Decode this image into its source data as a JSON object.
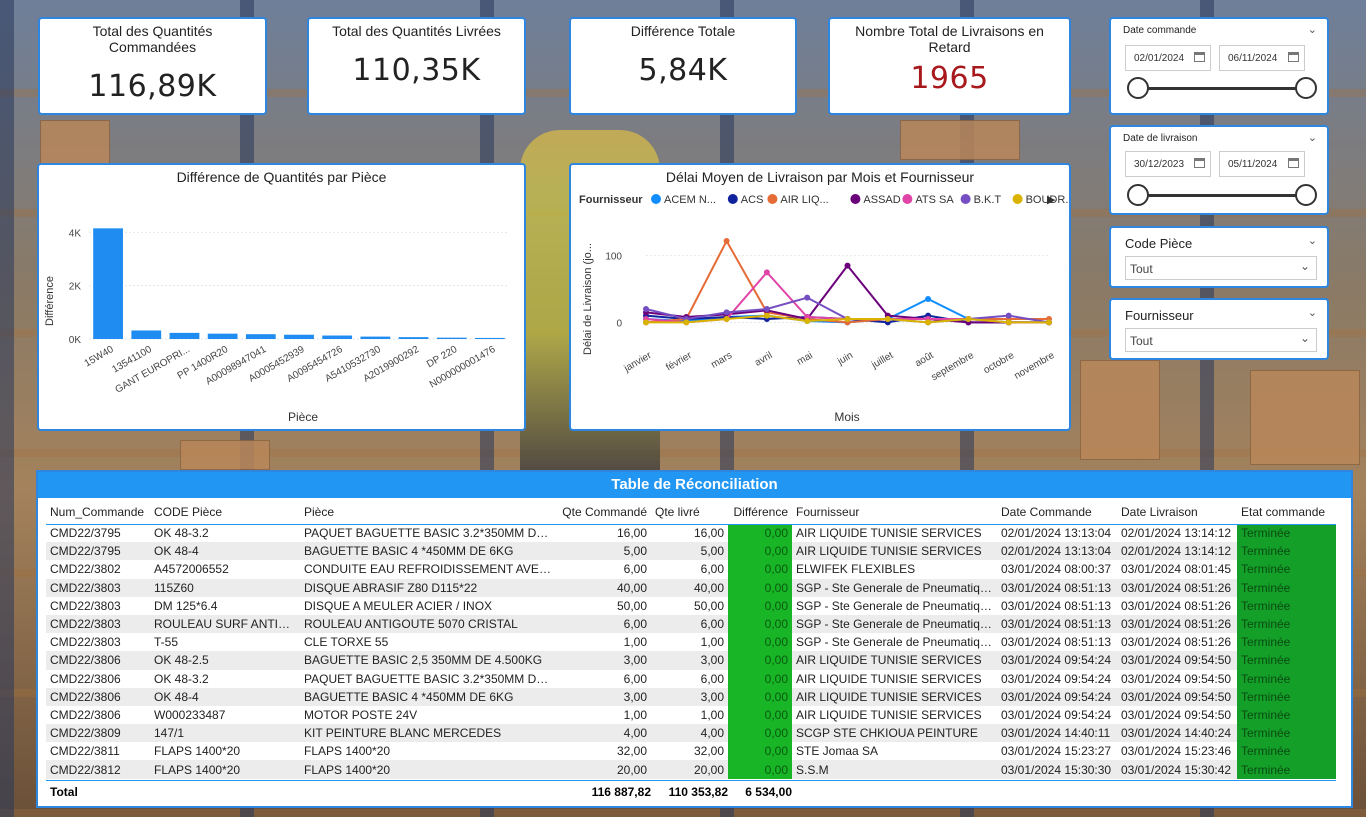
{
  "kpis": [
    {
      "title": "Total des Quantités Commandées",
      "value": "116,89K"
    },
    {
      "title": "Total des Quantités Livrées",
      "value": "110,35K"
    },
    {
      "title": "Différence Totale",
      "value": "5,84K"
    },
    {
      "title": "Nombre Total de Livraisons en Retard",
      "value": "1965"
    }
  ],
  "slicers": {
    "date_commande": {
      "label": "Date commande",
      "from": "02/01/2024",
      "to": "06/11/2024"
    },
    "date_livraison": {
      "label": "Date de livraison",
      "from": "30/12/2023",
      "to": "05/11/2024"
    },
    "code_piece": {
      "label": "Code Pièce",
      "value": "Tout"
    },
    "fournisseur": {
      "label": "Fournisseur",
      "value": "Tout"
    }
  },
  "colors": {
    "accent": "#2e86de",
    "bar": "#1e8cf0",
    "diff_cell": "#18b526",
    "etat_cell": "#14a028",
    "late_kpi": "#a8191e"
  },
  "chart_data": [
    {
      "type": "bar",
      "title": "Différence de Quantités par Pièce",
      "xlabel": "Pièce",
      "ylabel": "Différence",
      "yticks": [
        "0K",
        "2K",
        "4K"
      ],
      "ylim": [
        0,
        4500
      ],
      "categories": [
        "15W40",
        "13541100",
        "GANT EUROPRI...",
        "PP 1400R20",
        "A00098947041",
        "A0005452939",
        "A0095454726",
        "A5410532730",
        "A2019900292",
        "DP 220",
        "N000000001476"
      ],
      "values": [
        4150,
        320,
        230,
        200,
        180,
        160,
        130,
        90,
        70,
        50,
        40
      ]
    },
    {
      "type": "line",
      "title": "Délai Moyen de Livraison par Mois et Fournisseur",
      "xlabel": "Mois",
      "ylabel": "Délai de Livraison (jo...",
      "legend_title": "Fournisseur",
      "legend_placement": "top",
      "yticks": [
        "0",
        "100"
      ],
      "ylim": [
        -10,
        140
      ],
      "categories": [
        "janvier",
        "février",
        "mars",
        "avril",
        "mai",
        "juin",
        "juillet",
        "août",
        "septembre",
        "octobre",
        "novembre"
      ],
      "series": [
        {
          "name": "ACEM N...",
          "color": "#118dff",
          "values": [
            5,
            2,
            8,
            10,
            2,
            0,
            5,
            35,
            5,
            0,
            0
          ]
        },
        {
          "name": "ACS",
          "color": "#12239e",
          "values": [
            10,
            5,
            8,
            5,
            8,
            5,
            0,
            10,
            0,
            0,
            0
          ]
        },
        {
          "name": "AIR LIQ...",
          "color": "#e66c37",
          "values": [
            0,
            5,
            122,
            15,
            5,
            0,
            5,
            5,
            5,
            5,
            5
          ]
        },
        {
          "name": "ASSAD",
          "color": "#6b007b",
          "values": [
            15,
            8,
            12,
            18,
            5,
            85,
            10,
            5,
            0,
            0,
            0
          ]
        },
        {
          "name": "ATS SA",
          "color": "#e044a7",
          "values": [
            5,
            0,
            5,
            75,
            8,
            5,
            5,
            5,
            5,
            0,
            0
          ]
        },
        {
          "name": "B.K.T",
          "color": "#744ec2",
          "values": [
            20,
            5,
            15,
            20,
            37,
            5,
            5,
            0,
            5,
            10,
            0
          ]
        },
        {
          "name": "BOUDR...",
          "color": "#d9b300",
          "values": [
            0,
            0,
            5,
            10,
            2,
            5,
            5,
            0,
            5,
            0,
            0
          ]
        }
      ]
    }
  ],
  "table": {
    "title": "Table de Réconciliation",
    "columns": [
      "Num_Commande",
      "CODE Pièce",
      "Pièce",
      "Qte Commandé",
      "Qte livré",
      "Différence",
      "Fournisseur",
      "Date Commande",
      "Date Livraison",
      "Etat commande"
    ],
    "rows": [
      [
        "CMD22/3795",
        "OK 48-3.2",
        "PAQUET BAGUETTE BASIC 3.2*350MM DE 4....",
        "16,00",
        "16,00",
        "0,00",
        "AIR LIQUIDE TUNISIE SERVICES",
        "02/01/2024 13:13:04",
        "02/01/2024 13:14:12",
        "Terminée"
      ],
      [
        "CMD22/3795",
        "OK 48-4",
        "BAGUETTE BASIC 4 *450MM DE 6KG",
        "5,00",
        "5,00",
        "0,00",
        "AIR LIQUIDE TUNISIE SERVICES",
        "02/01/2024 13:13:04",
        "02/01/2024 13:14:12",
        "Terminée"
      ],
      [
        "CMD22/3802",
        "A4572006552",
        "CONDUITE EAU REFROIDISSEMENT AVEC R...",
        "6,00",
        "6,00",
        "0,00",
        "ELWIFEK FLEXIBLES",
        "03/01/2024 08:00:37",
        "03/01/2024 08:01:45",
        "Terminée"
      ],
      [
        "CMD22/3803",
        "115Z60",
        "DISQUE ABRASIF Z80 D115*22",
        "40,00",
        "40,00",
        "0,00",
        "SGP - Ste Generale de Pneumatique",
        "03/01/2024 08:51:13",
        "03/01/2024 08:51:26",
        "Terminée"
      ],
      [
        "CMD22/3803",
        "DM 125*6.4",
        "DISQUE A MEULER  ACIER / INOX",
        "50,00",
        "50,00",
        "0,00",
        "SGP - Ste Generale de Pneumatique",
        "03/01/2024 08:51:13",
        "03/01/2024 08:51:26",
        "Terminée"
      ],
      [
        "CMD22/3803",
        "ROULEAU SURF ANTIGO...",
        "ROULEAU ANTIGOUTE 5070 CRISTAL",
        "6,00",
        "6,00",
        "0,00",
        "SGP - Ste Generale de Pneumatique",
        "03/01/2024 08:51:13",
        "03/01/2024 08:51:26",
        "Terminée"
      ],
      [
        "CMD22/3803",
        "T-55",
        "CLE TORXE 55",
        "1,00",
        "1,00",
        "0,00",
        "SGP - Ste Generale de Pneumatique",
        "03/01/2024 08:51:13",
        "03/01/2024 08:51:26",
        "Terminée"
      ],
      [
        "CMD22/3806",
        "OK 48-2.5",
        "BAGUETTE BASIC 2,5 350MM DE 4.500KG",
        "3,00",
        "3,00",
        "0,00",
        "AIR LIQUIDE TUNISIE SERVICES",
        "03/01/2024 09:54:24",
        "03/01/2024 09:54:50",
        "Terminée"
      ],
      [
        "CMD22/3806",
        "OK 48-3.2",
        "PAQUET BAGUETTE BASIC 3.2*350MM DE 4....",
        "6,00",
        "6,00",
        "0,00",
        "AIR LIQUIDE TUNISIE SERVICES",
        "03/01/2024 09:54:24",
        "03/01/2024 09:54:50",
        "Terminée"
      ],
      [
        "CMD22/3806",
        "OK 48-4",
        "BAGUETTE BASIC 4 *450MM DE 6KG",
        "3,00",
        "3,00",
        "0,00",
        "AIR LIQUIDE TUNISIE SERVICES",
        "03/01/2024 09:54:24",
        "03/01/2024 09:54:50",
        "Terminée"
      ],
      [
        "CMD22/3806",
        "W000233487",
        "MOTOR POSTE 24V",
        "1,00",
        "1,00",
        "0,00",
        "AIR LIQUIDE TUNISIE SERVICES",
        "03/01/2024 09:54:24",
        "03/01/2024 09:54:50",
        "Terminée"
      ],
      [
        "CMD22/3809",
        "147/1",
        "KIT PEINTURE BLANC MERCEDES",
        "4,00",
        "4,00",
        "0,00",
        "SCGP STE CHKIOUA PEINTURE",
        "03/01/2024 14:40:11",
        "03/01/2024 14:40:24",
        "Terminée"
      ],
      [
        "CMD22/3811",
        "FLAPS 1400*20",
        "FLAPS 1400*20",
        "32,00",
        "32,00",
        "0,00",
        "STE Jomaa SA",
        "03/01/2024 15:23:27",
        "03/01/2024 15:23:46",
        "Terminée"
      ],
      [
        "CMD22/3812",
        "FLAPS 1400*20",
        "FLAPS 1400*20",
        "20,00",
        "20,00",
        "0,00",
        "S.S.M",
        "03/01/2024 15:30:30",
        "03/01/2024 15:30:42",
        "Terminée"
      ]
    ],
    "total": {
      "label": "Total",
      "qte_commande": "116 887,82",
      "qte_livre": "110 353,82",
      "difference": "6 534,00"
    }
  }
}
